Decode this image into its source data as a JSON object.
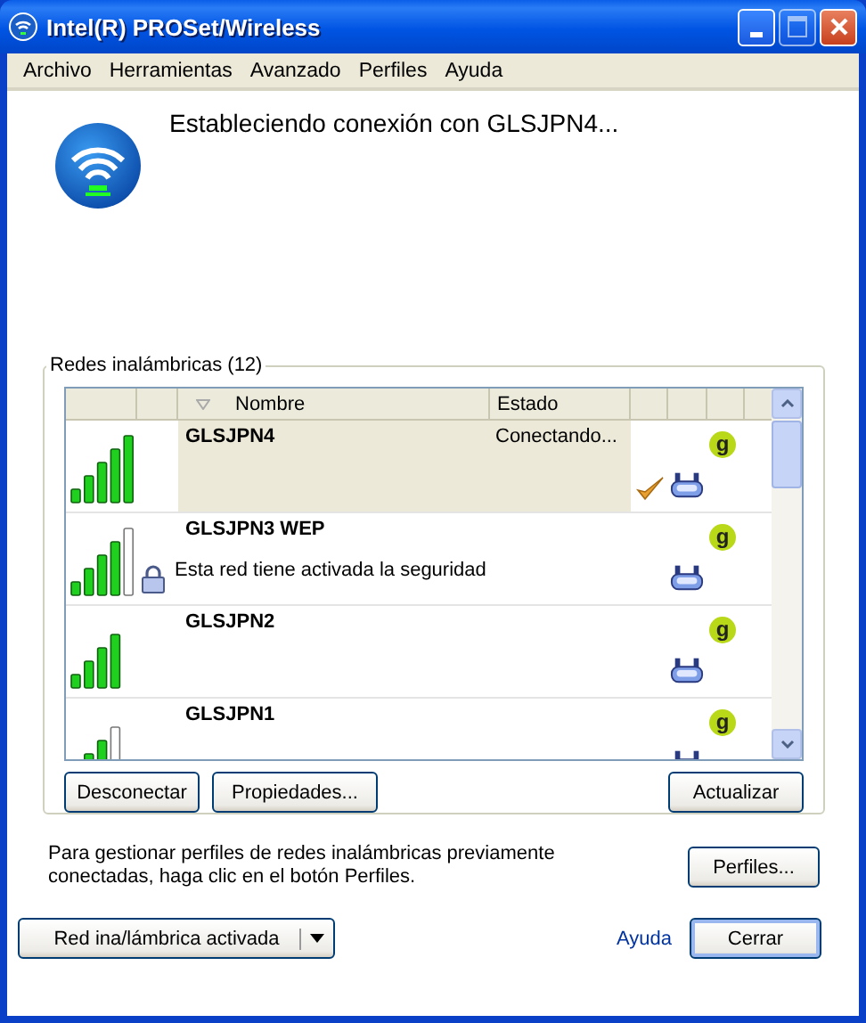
{
  "window": {
    "title": "Intel(R) PROSet/Wireless"
  },
  "menu": [
    "Archivo",
    "Herramientas",
    "Avanzado",
    "Perfiles",
    "Ayuda"
  ],
  "status_message": "Estableciendo conexión con GLSJPN4...",
  "networks_group": {
    "title": "Redes inalámbricas (12)",
    "columns": [
      {
        "kind": "blank"
      },
      {
        "kind": "blank"
      },
      {
        "kind": "text",
        "label": "Nombre",
        "sorted": true
      },
      {
        "kind": "text",
        "label": "Estado",
        "sorted": false
      },
      {
        "kind": "blank"
      },
      {
        "kind": "blank"
      },
      {
        "kind": "blank"
      }
    ],
    "rows": [
      {
        "name": "GLSJPN4",
        "status": "Conectando...",
        "kind": "excellent",
        "secured": false,
        "connecting": true,
        "selected": true,
        "band": "g"
      },
      {
        "name": "GLSJPN3 WEP",
        "kind": "very-good",
        "secured": true,
        "note": "Esta red tiene activada la seguridad",
        "connecting": false,
        "selected": false,
        "band": "g"
      },
      {
        "name": "GLSJPN2",
        "kind": "very-good-plain",
        "secured": false,
        "connecting": false,
        "selected": false,
        "band": "g"
      },
      {
        "name": "GLSJPN1",
        "kind": "good",
        "secured": false,
        "connecting": false,
        "selected": false,
        "band": "g"
      }
    ],
    "buttons": [
      "Desconectar",
      "Propiedades..."
    ],
    "refresh_button": "Actualizar"
  },
  "profiles_hint": "Para gestionar perfiles de redes inalámbricas previamente conectadas, haga clic en el botón Perfiles.",
  "profiles_button": "Perfiles...",
  "radio_button": "Red ina/lámbrica activada",
  "help_link": "Ayuda",
  "close_button": "Cerrar"
}
